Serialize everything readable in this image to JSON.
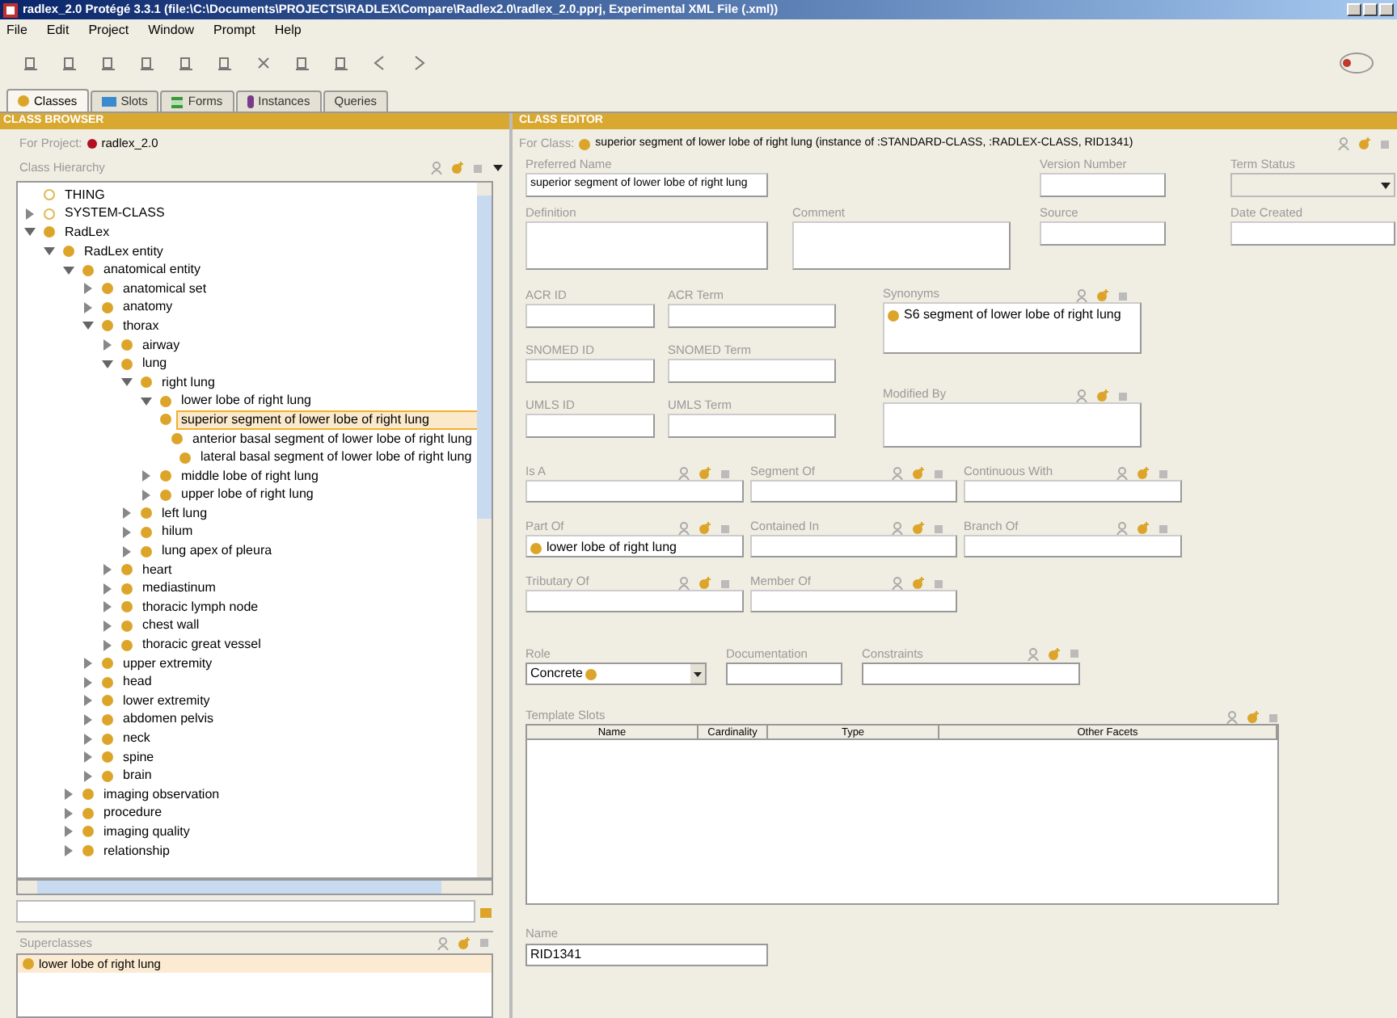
{
  "window": {
    "title": "radlex_2.0  Protégé 3.3.1    (file:\\C:\\Documents\\PROJECTS\\RADLEX\\Compare\\Radlex2.0\\radlex_2.0.pprj, Experimental XML File (.xml))"
  },
  "menu": [
    "File",
    "Edit",
    "Project",
    "Window",
    "Prompt",
    "Help"
  ],
  "tabs": [
    {
      "label": "Classes",
      "selected": true,
      "kind": "classes"
    },
    {
      "label": "Slots",
      "selected": false,
      "kind": "slots"
    },
    {
      "label": "Forms",
      "selected": false,
      "kind": "forms"
    },
    {
      "label": "Instances",
      "selected": false,
      "kind": "instances"
    },
    {
      "label": "Queries",
      "selected": false,
      "kind": "queries"
    }
  ],
  "class_browser": {
    "title": "CLASS BROWSER",
    "for_project_label": "For Project:",
    "project": "radlex_2.0",
    "hierarchy_label": "Class Hierarchy",
    "tree": [
      {
        "label": "THING",
        "kind": "system",
        "selected": false
      },
      {
        "label": "SYSTEM-CLASS",
        "kind": "system",
        "selected": false,
        "expanded": false
      },
      {
        "label": "RadLex",
        "kind": "class",
        "selected": false,
        "expanded": true,
        "children": [
          {
            "label": "RadLex entity",
            "kind": "class",
            "selected": false,
            "expanded": true,
            "children": [
              {
                "label": "anatomical entity",
                "kind": "class",
                "selected": false,
                "expanded": true,
                "children": [
                  {
                    "label": "anatomical set",
                    "kind": "class",
                    "selected": false,
                    "expanded": false
                  },
                  {
                    "label": "anatomy",
                    "kind": "class",
                    "selected": false,
                    "expanded": false
                  },
                  {
                    "label": "thorax",
                    "kind": "class",
                    "selected": false,
                    "expanded": true,
                    "children": [
                      {
                        "label": "airway",
                        "kind": "class",
                        "selected": false,
                        "expanded": false
                      },
                      {
                        "label": "lung",
                        "kind": "class",
                        "selected": false,
                        "expanded": true,
                        "children": [
                          {
                            "label": "right lung",
                            "kind": "class",
                            "selected": false,
                            "expanded": true,
                            "children": [
                              {
                                "label": "lower lobe of right lung",
                                "kind": "class",
                                "selected": false,
                                "expanded": true,
                                "children": [
                                  {
                                    "label": "superior segment of lower lobe of right lung",
                                    "kind": "class",
                                    "selected": true
                                  },
                                  {
                                    "label": "anterior basal segment of lower lobe of right lung",
                                    "kind": "class",
                                    "selected": false
                                  },
                                  {
                                    "label": "lateral basal segment of lower lobe of right lung",
                                    "kind": "class",
                                    "selected": false
                                  }
                                ]
                              },
                              {
                                "label": "middle lobe of right lung",
                                "kind": "class",
                                "selected": false,
                                "expanded": false
                              },
                              {
                                "label": "upper lobe of right lung",
                                "kind": "class",
                                "selected": false,
                                "expanded": false
                              }
                            ]
                          },
                          {
                            "label": "left lung",
                            "kind": "class",
                            "selected": false,
                            "expanded": false
                          },
                          {
                            "label": "hilum",
                            "kind": "class",
                            "selected": false,
                            "expanded": false
                          },
                          {
                            "label": "lung apex of pleura",
                            "kind": "class",
                            "selected": false,
                            "expanded": false
                          }
                        ]
                      },
                      {
                        "label": "heart",
                        "kind": "class",
                        "selected": false,
                        "expanded": false
                      },
                      {
                        "label": "mediastinum",
                        "kind": "class",
                        "selected": false,
                        "expanded": false
                      },
                      {
                        "label": "thoracic lymph node",
                        "kind": "class",
                        "selected": false,
                        "expanded": false
                      },
                      {
                        "label": "chest wall",
                        "kind": "class",
                        "selected": false,
                        "expanded": false
                      },
                      {
                        "label": "thoracic great vessel",
                        "kind": "class",
                        "selected": false,
                        "expanded": false
                      }
                    ]
                  },
                  {
                    "label": "upper extremity",
                    "kind": "class",
                    "selected": false,
                    "expanded": false
                  },
                  {
                    "label": "head",
                    "kind": "class",
                    "selected": false,
                    "expanded": false
                  },
                  {
                    "label": "lower extremity",
                    "kind": "class",
                    "selected": false,
                    "expanded": false
                  },
                  {
                    "label": "abdomen pelvis",
                    "kind": "class",
                    "selected": false,
                    "expanded": false
                  },
                  {
                    "label": "neck",
                    "kind": "class",
                    "selected": false,
                    "expanded": false
                  },
                  {
                    "label": "spine",
                    "kind": "class",
                    "selected": false,
                    "expanded": false
                  },
                  {
                    "label": "brain",
                    "kind": "class",
                    "selected": false,
                    "expanded": false
                  }
                ]
              },
              {
                "label": "imaging observation",
                "kind": "class",
                "selected": false,
                "expanded": false
              },
              {
                "label": "procedure",
                "kind": "class",
                "selected": false,
                "expanded": false
              },
              {
                "label": "imaging quality",
                "kind": "class",
                "selected": false,
                "expanded": false
              },
              {
                "label": "relationship",
                "kind": "class",
                "selected": false,
                "expanded": false
              }
            ]
          }
        ]
      }
    ],
    "superclasses_label": "Superclasses",
    "superclasses": [
      "lower lobe of right lung"
    ]
  },
  "class_editor": {
    "title": "CLASS EDITOR",
    "for_class_label": "For Class:",
    "for_class": "superior segment of lower lobe of right lung  (instance of :STANDARD-CLASS, :RADLEX-CLASS, RID1341)",
    "top_rows": [
      [
        {
          "label": "Preferred Name",
          "kind": "text",
          "value": "superior segment of lower lobe of right lung"
        },
        {
          "label": "Version Number",
          "kind": "text"
        },
        {
          "label": "Term Status",
          "kind": "combo"
        }
      ],
      [
        {
          "label": "Definition",
          "kind": "area"
        },
        {
          "label": "Comment",
          "kind": "area"
        },
        {
          "label": "Source",
          "kind": "text"
        },
        {
          "label": "Date Created",
          "kind": "text"
        }
      ]
    ],
    "id_rows": [
      [
        {
          "label": "ACR ID",
          "kind": "text"
        },
        {
          "label": "ACR Term",
          "kind": "text"
        }
      ],
      [
        {
          "label": "SNOMED ID",
          "kind": "text"
        },
        {
          "label": "SNOMED Term",
          "kind": "text"
        }
      ],
      [
        {
          "label": "UMLS ID",
          "kind": "text"
        },
        {
          "label": "UMLS Term",
          "kind": "text"
        }
      ]
    ],
    "side_lists": [
      {
        "label": "Synonyms",
        "items": [
          "S6 segment of lower lobe of right lung"
        ]
      },
      {
        "label": "Modified By"
      }
    ],
    "relation_rows": [
      [
        {
          "label": "Is A"
        },
        {
          "label": "Segment Of"
        },
        {
          "label": "Continuous With"
        }
      ],
      [
        {
          "label": "Part Of",
          "items": [
            "lower lobe of right lung"
          ]
        },
        {
          "label": "Contained In"
        },
        {
          "label": "Branch Of"
        }
      ],
      [
        {
          "label": "Tributary Of"
        },
        {
          "label": "Member Of"
        }
      ]
    ],
    "role": {
      "label": "Role",
      "value": "Concrete"
    },
    "documentation_label": "Documentation",
    "constraints_label": "Constraints",
    "template_slots": {
      "label": "Template Slots",
      "columns": [
        "Name",
        "Cardinality",
        "Type",
        "Other Facets"
      ]
    },
    "name": {
      "label": "Name",
      "value": "RID1341"
    }
  }
}
